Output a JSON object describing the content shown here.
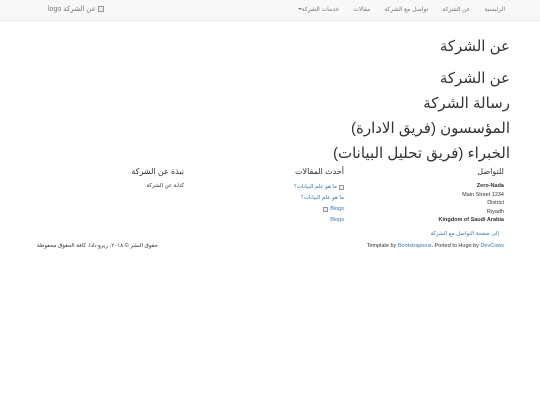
{
  "navbar": {
    "brand_alt": "عن الشركة logo",
    "items": [
      {
        "label": "الرئيسية"
      },
      {
        "label": "عن الشركة"
      },
      {
        "label": "تواصل مع الشركة"
      },
      {
        "label": "مقالات"
      },
      {
        "label": "خدمات الشركة",
        "dropdown": true
      }
    ]
  },
  "page_title": "عن الشركة",
  "sections": [
    "عن الشركة",
    "رسالة الشركة",
    "المؤسسون (فريق الادارة)",
    "الخبراء (فريق تحليل البيانات)"
  ],
  "footer": {
    "contact": {
      "title": "للتواصل",
      "name": "Zero-Nada",
      "street": "Main Street 1234",
      "district": "District",
      "city": "Riyadh",
      "country": "Kingdom of Saudi Arabia",
      "contact_link": "إلى صفحة التواصل مع الشركة"
    },
    "articles": {
      "title": "أحدث المقالات",
      "items": [
        {
          "label": "ما هو علم البيانات؟",
          "has_image": true
        },
        {
          "label": "ما هو علم البيانات؟",
          "has_image": false
        },
        {
          "label": "Blogs",
          "has_image": true
        },
        {
          "label": "Blogs",
          "has_image": false
        }
      ]
    },
    "about": {
      "title": "نبذة عن الشركة",
      "text": "كتابة عن الشركة"
    },
    "copyright": "حقوق النشر © ٢٠١٨، زيرو-نادا. كافة الحقوق محفوظة",
    "credit": {
      "prefix": "Template by",
      "bootstrap": "Bootstrapious",
      "middle": ". Ported to Hugo by",
      "devcows": "DevCows"
    }
  }
}
